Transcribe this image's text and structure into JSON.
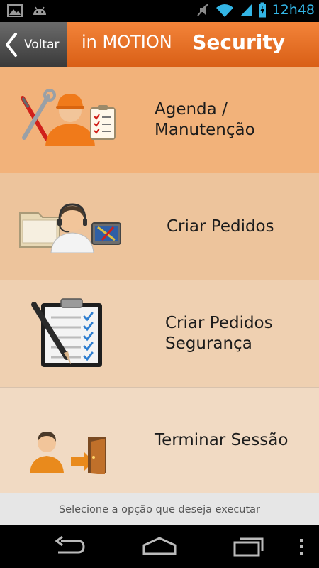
{
  "status_bar": {
    "time": "12h48",
    "icons": [
      "gallery-icon",
      "android-icon",
      "mute-icon",
      "wifi-icon",
      "signal-icon",
      "battery-icon"
    ]
  },
  "header": {
    "back_label": "Voltar",
    "app_name": "in MOTION",
    "section_title": "Security"
  },
  "menu": {
    "items": [
      {
        "label": "Agenda / Manutenção",
        "icon": "maintenance-worker-icon"
      },
      {
        "label": "Criar Pedidos",
        "icon": "support-agent-icon"
      },
      {
        "label": "Criar Pedidos Segurança",
        "icon": "checklist-clipboard-icon"
      },
      {
        "label": "Terminar Sessão",
        "icon": "logout-door-icon"
      }
    ]
  },
  "hint": "Selecione a opção que deseja executar",
  "navbar": {
    "buttons": [
      "back-nav-icon",
      "home-nav-icon",
      "recent-apps-icon",
      "overflow-menu-icon"
    ]
  },
  "colors": {
    "header_orange": "#e8742c",
    "status_blue": "#33b5e5"
  }
}
